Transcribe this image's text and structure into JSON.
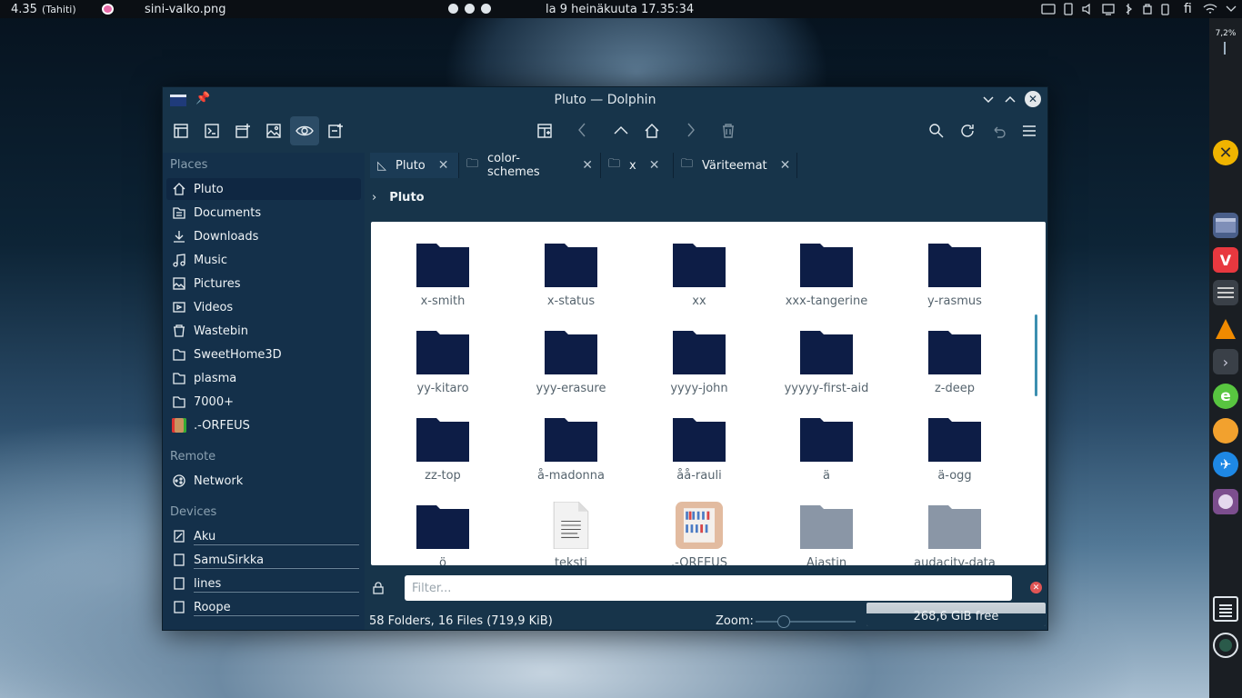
{
  "topbar": {
    "time_left": "4.35",
    "timezone": "(Tahiti)",
    "task_title": "sini-valko.png",
    "clock": "la 9 heinäkuuta 17.35:34",
    "lang": "fi"
  },
  "dock": {
    "cpu": "7,2%",
    "items": [
      "close-app",
      "files",
      "vivaldi",
      "mixer",
      "vlc",
      "arrow",
      "edge",
      "orange",
      "kite",
      "media",
      "notes",
      "clock"
    ]
  },
  "window": {
    "title": "Pluto — Dolphin"
  },
  "places": {
    "header": "Places",
    "items": [
      "Pluto",
      "Documents",
      "Downloads",
      "Music",
      "Pictures",
      "Videos",
      "Wastebin",
      "SweetHome3D",
      "plasma",
      "7000+",
      ".-ORFEUS"
    ],
    "remote_header": "Remote",
    "remote_items": [
      "Network"
    ],
    "devices_header": "Devices",
    "devices": [
      "Aku",
      "SamuSirkka",
      "lines",
      "Roope"
    ]
  },
  "tabs": [
    {
      "label": "Pluto"
    },
    {
      "label": "color-schemes"
    },
    {
      "label": "x"
    },
    {
      "label": "Väriteemat"
    }
  ],
  "breadcrumb": "Pluto",
  "files": {
    "rows": [
      [
        "x-smith",
        "x-status",
        "xx",
        "xxx-tangerine",
        "y-rasmus"
      ],
      [
        "yy-kitaro",
        "yyy-erasure",
        "yyyy-john",
        "yyyyy-first-aid",
        "z-deep"
      ],
      [
        "zz-top",
        "å-madonna",
        "åå-rauli",
        "ä",
        "ä-ogg"
      ],
      [
        "ö",
        "teksti",
        ".-ORFEUS",
        "Ajastin",
        "audacity-data"
      ]
    ]
  },
  "filter": {
    "placeholder": "Filter..."
  },
  "status": {
    "summary": "58 Folders, 16 Files (719,9 KiB)",
    "zoom_label": "Zoom:",
    "free": "268,6 GiB free"
  }
}
